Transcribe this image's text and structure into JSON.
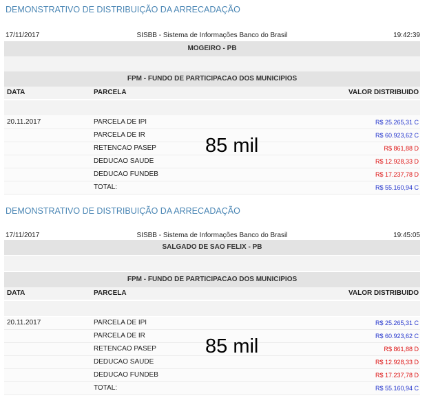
{
  "reports": [
    {
      "title": "DEMONSTRATIVO DE DISTRIBUIÇÃO DA ARRECADAÇÃO",
      "date": "17/11/2017",
      "system": "SISBB - Sistema de Informações Banco do Brasil",
      "time": "19:42:39",
      "municipality": "MOGEIRO - PB",
      "fund": "FPM - FUNDO DE PARTICIPACAO DOS MUNICIPIOS",
      "columns": [
        "DATA",
        "PARCELA",
        "VALOR DISTRIBUIDO"
      ],
      "rows": [
        {
          "date": "20.11.2017",
          "parcela": "PARCELA DE IPI",
          "valor": "R$ 25.265,31 C",
          "type": "C"
        },
        {
          "date": "",
          "parcela": "PARCELA DE IR",
          "valor": "R$ 60.923,62 C",
          "type": "C"
        },
        {
          "date": "",
          "parcela": "RETENCAO PASEP",
          "valor": "R$ 861,88 D",
          "type": "D"
        },
        {
          "date": "",
          "parcela": "DEDUCAO SAUDE",
          "valor": "R$ 12.928,33 D",
          "type": "D"
        },
        {
          "date": "",
          "parcela": "DEDUCAO FUNDEB",
          "valor": "R$ 17.237,78 D",
          "type": "D"
        },
        {
          "date": "",
          "parcela": "TOTAL:",
          "valor": "R$ 55.160,94 C",
          "type": "C"
        }
      ],
      "note": "85 mil"
    },
    {
      "title": "DEMONSTRATIVO DE DISTRIBUIÇÃO DA ARRECADAÇÃO",
      "date": "17/11/2017",
      "system": "SISBB - Sistema de Informações Banco do Brasil",
      "time": "19:45:05",
      "municipality": "SALGADO DE SAO FELIX - PB",
      "fund": "FPM - FUNDO DE PARTICIPACAO DOS MUNICIPIOS",
      "columns": [
        "DATA",
        "PARCELA",
        "VALOR DISTRIBUIDO"
      ],
      "rows": [
        {
          "date": "20.11.2017",
          "parcela": "PARCELA DE IPI",
          "valor": "R$ 25.265,31 C",
          "type": "C"
        },
        {
          "date": "",
          "parcela": "PARCELA DE IR",
          "valor": "R$ 60.923,62 C",
          "type": "C"
        },
        {
          "date": "",
          "parcela": "RETENCAO PASEP",
          "valor": "R$ 861,88 D",
          "type": "D"
        },
        {
          "date": "",
          "parcela": "DEDUCAO SAUDE",
          "valor": "R$ 12.928,33 D",
          "type": "D"
        },
        {
          "date": "",
          "parcela": "DEDUCAO FUNDEB",
          "valor": "R$ 17.237,78 D",
          "type": "D"
        },
        {
          "date": "",
          "parcela": "TOTAL:",
          "valor": "R$ 55.160,94 C",
          "type": "C"
        }
      ],
      "note": "85 mil"
    }
  ],
  "colors": {
    "title": "#4a86b4",
    "credit": "#2233cc",
    "debit": "#dd1111"
  }
}
